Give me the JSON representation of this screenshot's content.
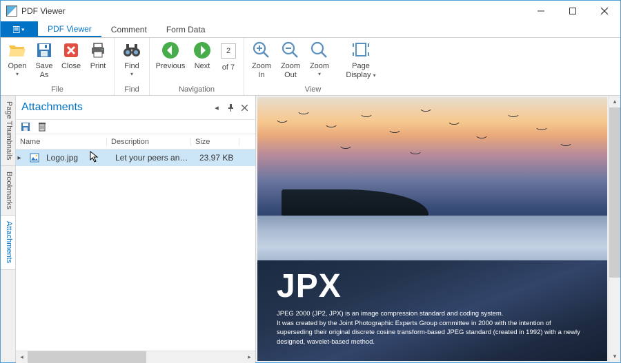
{
  "window": {
    "title": "PDF Viewer"
  },
  "menubar": {
    "tabs": [
      "PDF Viewer",
      "Comment",
      "Form Data"
    ]
  },
  "ribbon": {
    "file": {
      "label": "File",
      "open": "Open",
      "saveas": "Save\nAs",
      "close": "Close",
      "print": "Print"
    },
    "find": {
      "label": "Find",
      "find": "Find"
    },
    "nav": {
      "label": "Navigation",
      "prev": "Previous",
      "next": "Next",
      "of": "of 7",
      "page": "2"
    },
    "view": {
      "label": "View",
      "zin": "Zoom\nIn",
      "zout": "Zoom\nOut",
      "zoom": "Zoom",
      "pd": "Page\nDisplay"
    }
  },
  "sidetabs": [
    "Page Thumbnails",
    "Bookmarks",
    "Attachments"
  ],
  "panel": {
    "title": "Attachments",
    "cols": {
      "name": "Name",
      "desc": "Description",
      "size": "Size"
    },
    "rows": [
      {
        "name": "Logo.jpg",
        "desc": "Let your peers and...",
        "size": "23.97 KB"
      }
    ]
  },
  "doc": {
    "heading": "JPX",
    "body": "JPEG 2000 (JP2, JPX) is an image compression standard and coding system.\nIt was created by the Joint Photographic Experts Group committee in 2000 with the intention of superseding their original discrete cosine transform-based JPEG standard (created in 1992) with a newly designed, wavelet-based method."
  }
}
